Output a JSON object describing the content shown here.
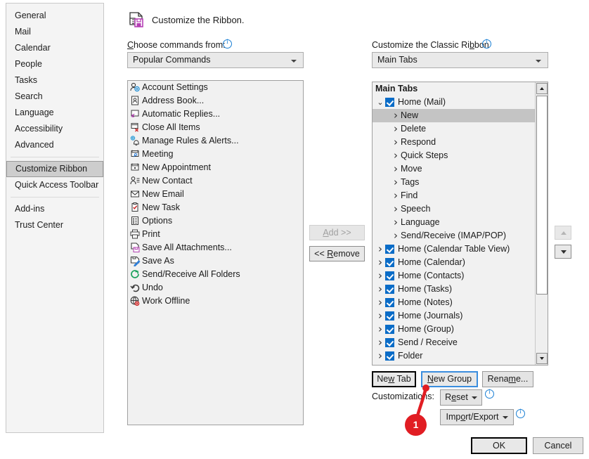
{
  "sidebar": {
    "items": [
      {
        "label": "General",
        "selected": false
      },
      {
        "label": "Mail",
        "selected": false
      },
      {
        "label": "Calendar",
        "selected": false
      },
      {
        "label": "People",
        "selected": false
      },
      {
        "label": "Tasks",
        "selected": false
      },
      {
        "label": "Search",
        "selected": false
      },
      {
        "label": "Language",
        "selected": false
      },
      {
        "label": "Accessibility",
        "selected": false
      },
      {
        "label": "Advanced",
        "selected": false
      },
      {
        "label": "Customize Ribbon",
        "selected": true
      },
      {
        "label": "Quick Access Toolbar",
        "selected": false
      },
      {
        "label": "Add-ins",
        "selected": false
      },
      {
        "label": "Trust Center",
        "selected": false
      }
    ]
  },
  "header": {
    "title": "Customize the Ribbon.",
    "icon": "customize-ribbon-icon"
  },
  "left_panel": {
    "label": "Choose commands from:",
    "label_accesskey": "C",
    "info_icon": "info-icon",
    "dropdown_value": "Popular Commands",
    "commands": [
      {
        "label": "Account Settings",
        "icon": "account-settings-icon"
      },
      {
        "label": "Address Book...",
        "icon": "address-book-icon"
      },
      {
        "label": "Automatic Replies...",
        "icon": "automatic-replies-icon"
      },
      {
        "label": "Close All Items",
        "icon": "close-all-items-icon"
      },
      {
        "label": "Manage Rules & Alerts...",
        "icon": "manage-rules-alerts-icon"
      },
      {
        "label": "Meeting",
        "icon": "meeting-icon"
      },
      {
        "label": "New Appointment",
        "icon": "new-appointment-icon"
      },
      {
        "label": "New Contact",
        "icon": "new-contact-icon"
      },
      {
        "label": "New Email",
        "icon": "new-email-icon"
      },
      {
        "label": "New Task",
        "icon": "new-task-icon"
      },
      {
        "label": "Options",
        "icon": "options-icon"
      },
      {
        "label": "Print",
        "icon": "print-icon"
      },
      {
        "label": "Save All Attachments...",
        "icon": "save-all-attachments-icon"
      },
      {
        "label": "Save As",
        "icon": "save-as-icon"
      },
      {
        "label": "Send/Receive All Folders",
        "icon": "send-receive-icon"
      },
      {
        "label": "Undo",
        "icon": "undo-icon"
      },
      {
        "label": "Work Offline",
        "icon": "work-offline-icon"
      }
    ]
  },
  "middle": {
    "add_label": "Add >>",
    "add_accesskey": "A",
    "add_enabled": false,
    "remove_label": "<< Remove",
    "remove_accesskey": "R",
    "remove_enabled": true,
    "move_up_icon": "move-up-icon",
    "move_down_icon": "move-down-icon"
  },
  "right_panel": {
    "label": "Customize the Classic Ribbon",
    "label_accesskey": "b",
    "info_icon": "info-icon",
    "dropdown_value": "Main Tabs",
    "tree_header": "Main Tabs",
    "tree": [
      {
        "label": "Home (Mail)",
        "level": 1,
        "expander": "chevron-down",
        "checkbox": true,
        "selected": false
      },
      {
        "label": "New",
        "level": 2,
        "expander": "chevron-right",
        "checkbox": false,
        "selected": true
      },
      {
        "label": "Delete",
        "level": 2,
        "expander": "chevron-right",
        "checkbox": false,
        "selected": false
      },
      {
        "label": "Respond",
        "level": 2,
        "expander": "chevron-right",
        "checkbox": false,
        "selected": false
      },
      {
        "label": "Quick Steps",
        "level": 2,
        "expander": "chevron-right",
        "checkbox": false,
        "selected": false
      },
      {
        "label": "Move",
        "level": 2,
        "expander": "chevron-right",
        "checkbox": false,
        "selected": false
      },
      {
        "label": "Tags",
        "level": 2,
        "expander": "chevron-right",
        "checkbox": false,
        "selected": false
      },
      {
        "label": "Find",
        "level": 2,
        "expander": "chevron-right",
        "checkbox": false,
        "selected": false
      },
      {
        "label": "Speech",
        "level": 2,
        "expander": "chevron-right",
        "checkbox": false,
        "selected": false
      },
      {
        "label": "Language",
        "level": 2,
        "expander": "chevron-right",
        "checkbox": false,
        "selected": false
      },
      {
        "label": "Send/Receive (IMAP/POP)",
        "level": 2,
        "expander": "chevron-right",
        "checkbox": false,
        "selected": false
      },
      {
        "label": "Home (Calendar Table View)",
        "level": 1,
        "expander": "chevron-right",
        "checkbox": true,
        "selected": false
      },
      {
        "label": "Home (Calendar)",
        "level": 1,
        "expander": "chevron-right",
        "checkbox": true,
        "selected": false
      },
      {
        "label": "Home (Contacts)",
        "level": 1,
        "expander": "chevron-right",
        "checkbox": true,
        "selected": false
      },
      {
        "label": "Home (Tasks)",
        "level": 1,
        "expander": "chevron-right",
        "checkbox": true,
        "selected": false
      },
      {
        "label": "Home (Notes)",
        "level": 1,
        "expander": "chevron-right",
        "checkbox": true,
        "selected": false
      },
      {
        "label": "Home (Journals)",
        "level": 1,
        "expander": "chevron-right",
        "checkbox": true,
        "selected": false
      },
      {
        "label": "Home (Group)",
        "level": 1,
        "expander": "chevron-right",
        "checkbox": true,
        "selected": false
      },
      {
        "label": "Send / Receive",
        "level": 1,
        "expander": "chevron-right",
        "checkbox": true,
        "selected": false
      },
      {
        "label": "Folder",
        "level": 1,
        "expander": "chevron-right",
        "checkbox": true,
        "selected": false
      }
    ],
    "scrollbar": {
      "up_icon": "scroll-up-icon",
      "down_icon": "scroll-down-icon",
      "thumb": "scroll-thumb"
    }
  },
  "tab_buttons": {
    "new_tab": "New Tab",
    "new_tab_accesskey": "w",
    "new_group": "New Group",
    "new_group_accesskey": "N",
    "rename": "Rename...",
    "rename_accesskey": "m"
  },
  "customizations": {
    "label": "Customizations:",
    "reset": "Reset",
    "reset_accesskey": "e",
    "reset_info_icon": "info-icon",
    "import_export": "Import/Export",
    "import_export_accesskey": "o",
    "import_info_icon": "info-icon"
  },
  "dialog_buttons": {
    "ok": "OK",
    "cancel": "Cancel"
  },
  "callout": {
    "number": "1",
    "color": "#e11d23",
    "target": "new-group-button"
  }
}
